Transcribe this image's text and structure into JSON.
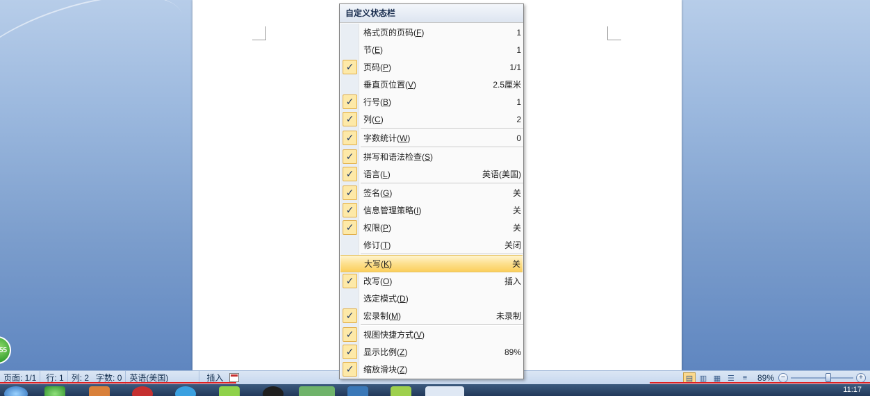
{
  "menu": {
    "title": "自定义状态栏",
    "groups": [
      [
        {
          "label": "格式页的页码",
          "key": "F",
          "value": "1",
          "checked": false
        },
        {
          "label": "节",
          "key": "E",
          "value": "1",
          "checked": false
        },
        {
          "label": "页码",
          "key": "P",
          "value": "1/1",
          "checked": true
        },
        {
          "label": "垂直页位置",
          "key": "V",
          "value": "2.5厘米",
          "checked": false
        },
        {
          "label": "行号",
          "key": "B",
          "value": "1",
          "checked": true
        },
        {
          "label": "列",
          "key": "C",
          "value": "2",
          "checked": true
        }
      ],
      [
        {
          "label": "字数统计",
          "key": "W",
          "value": "0",
          "checked": true
        }
      ],
      [
        {
          "label": "拼写和语法检查",
          "key": "S",
          "value": "",
          "checked": true
        },
        {
          "label": "语言",
          "key": "L",
          "value": "英语(美国)",
          "checked": true
        }
      ],
      [
        {
          "label": "签名",
          "key": "G",
          "value": "关",
          "checked": true
        },
        {
          "label": "信息管理策略",
          "key": "I",
          "value": "关",
          "checked": true
        },
        {
          "label": "权限",
          "key": "P",
          "value": "关",
          "checked": true
        },
        {
          "label": "修订",
          "key": "T",
          "value": "关闭",
          "checked": false
        }
      ],
      [
        {
          "label": "大写",
          "key": "K",
          "value": "关",
          "checked": false,
          "highlighted": true
        },
        {
          "label": "改写",
          "key": "O",
          "value": "插入",
          "checked": true
        },
        {
          "label": "选定模式",
          "key": "D",
          "value": "",
          "checked": false
        },
        {
          "label": "宏录制",
          "key": "M",
          "value": "未录制",
          "checked": true
        }
      ],
      [
        {
          "label": "视图快捷方式",
          "key": "V",
          "value": "",
          "checked": true
        },
        {
          "label": "显示比例",
          "key": "Z",
          "value": "89%",
          "checked": true
        },
        {
          "label": "缩放滑块",
          "key": "Z",
          "value": "",
          "checked": true
        }
      ]
    ]
  },
  "statusbar": {
    "page": "页面: 1/1",
    "line": "行: 1",
    "column": "列: 2",
    "words": "字数: 0",
    "language": "英语(美国)",
    "insert_mode": "插入",
    "zoom": "89%"
  },
  "taskbar": {
    "time": "11:17"
  },
  "misc": {
    "badge_text": "55"
  },
  "colors": {
    "highlight": "#fde08e",
    "check_bg": "#fde9a8",
    "underline_red": "#e02020"
  }
}
